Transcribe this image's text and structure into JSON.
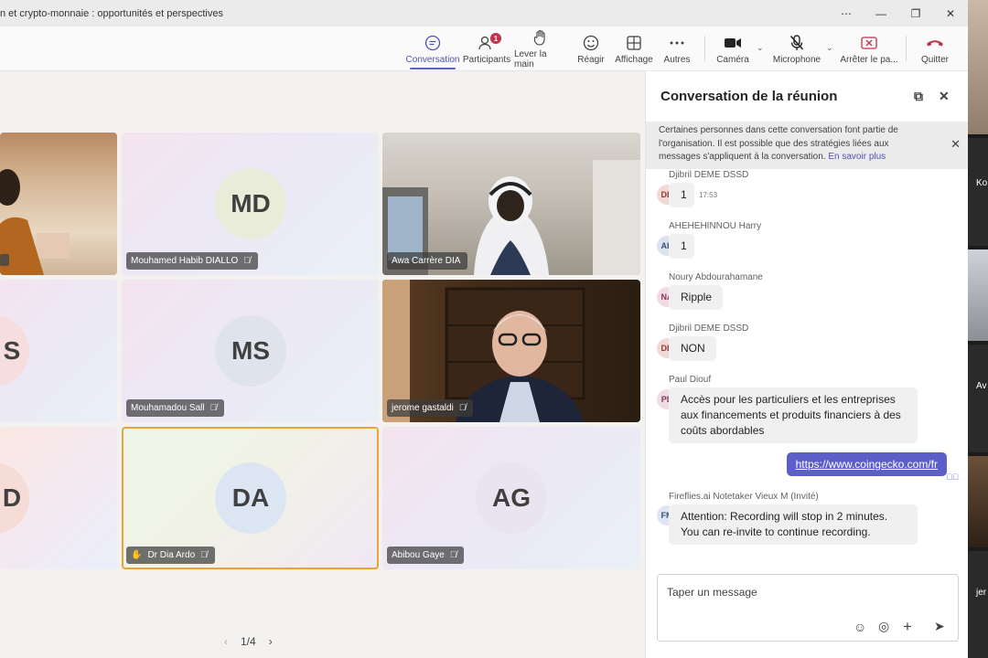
{
  "window": {
    "title": "n et crypto-monnaie : opportunités et perspectives",
    "buttons": [
      "more-icon",
      "minimize-icon",
      "restore-icon",
      "close-icon"
    ]
  },
  "toolbar": {
    "conversation": "Conversation",
    "participants": "Participants",
    "participants_badge": "1",
    "raise_hand": "Lever la main",
    "react": "Réagir",
    "view": "Affichage",
    "more": "Autres",
    "camera": "Caméra",
    "microphone": "Microphone",
    "stop_share": "Arrêter le pa...",
    "leave": "Quitter"
  },
  "tiles": [
    {
      "kind": "video",
      "name": ""
    },
    {
      "kind": "avatar",
      "initials": "MD",
      "name": "Mouhamed Habib DIALLO"
    },
    {
      "kind": "video",
      "name": "Awa Carrère DIA"
    },
    {
      "kind": "avatar",
      "initials": "S",
      "name": ""
    },
    {
      "kind": "avatar",
      "initials": "MS",
      "name": "Mouhamadou Sall"
    },
    {
      "kind": "video",
      "name": "jerome gastaldi"
    },
    {
      "kind": "avatar",
      "initials": "D",
      "name": ""
    },
    {
      "kind": "avatar",
      "initials": "DA",
      "name": "Dr Dia Ardo",
      "hand_raised": true,
      "speaking": true
    },
    {
      "kind": "avatar",
      "initials": "AG",
      "name": "Abibou Gaye"
    }
  ],
  "pager": {
    "label": "1/4"
  },
  "chat": {
    "title": "Conversation de la réunion",
    "notice": "Certaines personnes dans cette conversation font partie de l'organisation. Il est possible que des stratégies liées aux messages s'appliquent à la conversation.",
    "notice_link": "En savoir plus",
    "messages": [
      {
        "sender": "Djibril DEME DSSD",
        "initials": "DD",
        "text": "1",
        "time": "17:53"
      },
      {
        "sender": "AHEHEHINNOU Harry",
        "initials": "AH",
        "text": "1"
      },
      {
        "sender": "Noury Abdourahamane",
        "initials": "NA",
        "text": "Ripple"
      },
      {
        "sender": "Djibril DEME DSSD",
        "initials": "DD",
        "text": "NON"
      },
      {
        "sender": "Paul Diouf",
        "initials": "PD",
        "text": "Accès pour les particuliers et les entreprises aux financements et produits financiers à des coûts abordables"
      },
      {
        "own": true,
        "text": "https://www.coingecko.com/fr"
      },
      {
        "sender": "Fireflies.ai Notetaker Vieux M (Invité)",
        "initials": "FM",
        "text": "Attention: Recording will stop in 2 minutes. You can re-invite to continue recording."
      }
    ],
    "compose_placeholder": "Taper un message"
  },
  "filmstrip": [
    "Ko",
    "Av",
    "jer"
  ],
  "colors": {
    "accent": "#5b5fc7",
    "leave": "#c4314b",
    "speaking": "#e8a33b"
  }
}
